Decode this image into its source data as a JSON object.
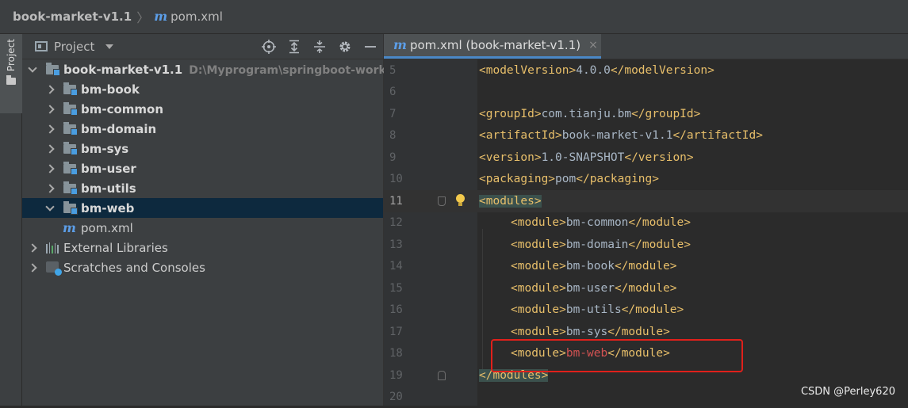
{
  "breadcrumb": {
    "project": "book-market-v1.1",
    "file_icon": "m-icon",
    "file": "pom.xml"
  },
  "side_tab": {
    "label": "Project"
  },
  "project_panel": {
    "title": "Project",
    "tools": [
      "locate-icon",
      "expand-all-icon",
      "collapse-all-icon",
      "gear-icon",
      "minimize-icon"
    ],
    "tree": [
      {
        "label": "book-market-v1.1",
        "hint": "D:\\Myprogram\\springboot-workspa",
        "kind": "module",
        "expanded": true,
        "bold": true
      },
      {
        "label": "bm-book",
        "kind": "module",
        "expanded": false,
        "bold": true
      },
      {
        "label": "bm-common",
        "kind": "module",
        "expanded": false,
        "bold": true
      },
      {
        "label": "bm-domain",
        "kind": "module",
        "expanded": false,
        "bold": true
      },
      {
        "label": "bm-sys",
        "kind": "module",
        "expanded": false,
        "bold": true
      },
      {
        "label": "bm-user",
        "kind": "module",
        "expanded": false,
        "bold": true
      },
      {
        "label": "bm-utils",
        "kind": "module",
        "expanded": false,
        "bold": true
      },
      {
        "label": "bm-web",
        "kind": "module",
        "expanded": true,
        "bold": true,
        "selected": true
      },
      {
        "label": "pom.xml",
        "kind": "maven-file"
      },
      {
        "label": "External Libraries",
        "kind": "libraries",
        "expanded": false
      },
      {
        "label": "Scratches and Consoles",
        "kind": "scratches",
        "expanded": false
      }
    ]
  },
  "editor": {
    "tab_label": "pom.xml (book-market-v1.1)",
    "tab_close": "×",
    "lines": [
      {
        "num": "5",
        "tag_open": "<modelVersion>",
        "text": "4.0.0",
        "tag_close": "</modelVersion>"
      },
      {
        "num": "6"
      },
      {
        "num": "7",
        "tag_open": "<groupId>",
        "text": "com.tianju.bm",
        "tag_close": "</groupId>"
      },
      {
        "num": "8",
        "tag_open": "<artifactId>",
        "text": "book-market-v1.1",
        "tag_close": "</artifactId>"
      },
      {
        "num": "9",
        "tag_open": "<version>",
        "text": "1.0-SNAPSHOT",
        "tag_close": "</version>"
      },
      {
        "num": "10",
        "tag_open": "<packaging>",
        "text": "pom",
        "tag_close": "</packaging>"
      },
      {
        "num": "11",
        "tag_open": "<modules>",
        "current": true
      },
      {
        "num": "12",
        "tag_open": "<module>",
        "text": "bm-common",
        "tag_close": "</module>"
      },
      {
        "num": "13",
        "tag_open": "<module>",
        "text": "bm-domain",
        "tag_close": "</module>"
      },
      {
        "num": "14",
        "tag_open": "<module>",
        "text": "bm-book",
        "tag_close": "</module>"
      },
      {
        "num": "15",
        "tag_open": "<module>",
        "text": "bm-user",
        "tag_close": "</module>"
      },
      {
        "num": "16",
        "tag_open": "<module>",
        "text": "bm-utils",
        "tag_close": "</module>"
      },
      {
        "num": "17",
        "tag_open": "<module>",
        "text": "bm-sys",
        "tag_close": "</module>"
      },
      {
        "num": "18",
        "tag_open": "<module>",
        "text": "bm-web",
        "tag_close": "</module>",
        "error": true
      },
      {
        "num": "19",
        "tag_open": "</modules>"
      },
      {
        "num": "20"
      }
    ]
  },
  "watermark": "CSDN @Perley620",
  "colors": {
    "tag": "#e8bf6a",
    "text": "#a9b7c6",
    "error_text": "#d25252",
    "annotation_box": "#e0201b",
    "selection": "#0d293e"
  }
}
